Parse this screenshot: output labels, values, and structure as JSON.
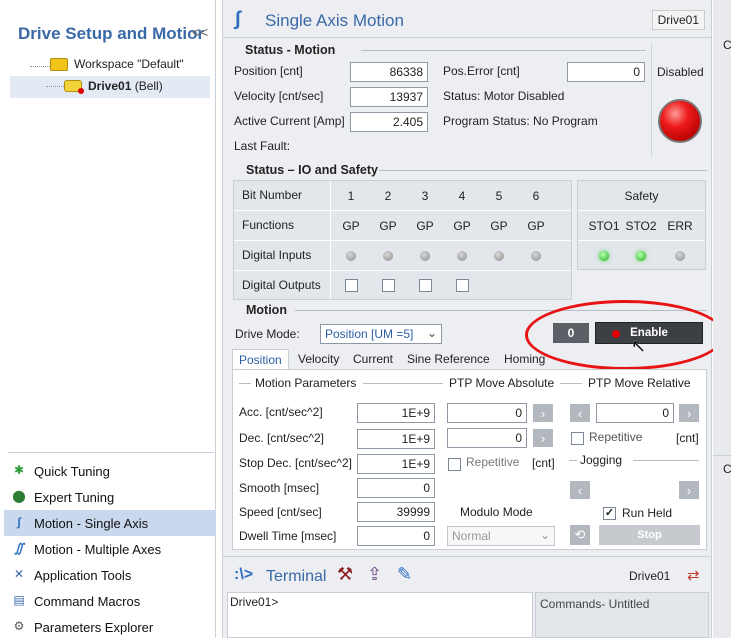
{
  "left": {
    "title": "Drive Setup and Motior",
    "collapse": "<<",
    "tree": {
      "workspace": "Workspace \"Default\"",
      "drive": "Drive01",
      "drive_suffix": "(Bell)"
    },
    "nav": [
      {
        "label": "Quick Tuning",
        "icon": "quick-tuning-icon"
      },
      {
        "label": "Expert Tuning",
        "icon": "expert-tuning-icon"
      },
      {
        "label": "Motion - Single Axis",
        "icon": "motion-single-icon"
      },
      {
        "label": "Motion - Multiple Axes",
        "icon": "motion-multi-icon"
      },
      {
        "label": "Application Tools",
        "icon": "tools-icon"
      },
      {
        "label": "Command Macros",
        "icon": "macros-icon"
      },
      {
        "label": "Parameters Explorer",
        "icon": "params-icon"
      }
    ]
  },
  "header": {
    "title": "Single Axis Motion",
    "drive": "Drive01"
  },
  "status_motion": {
    "title": "Status - Motion",
    "position_label": "Position [cnt]",
    "position": "86338",
    "velocity_label": "Velocity [cnt/sec]",
    "velocity": "13937",
    "current_label": "Active Current [Amp]",
    "current": "2.405",
    "last_fault_label": "Last Fault:",
    "pos_error_label": "Pos.Error [cnt]",
    "pos_error": "0",
    "status_text": "Status: Motor Disabled",
    "program_status": "Program Status: No Program",
    "disabled": "Disabled"
  },
  "io": {
    "title": "Status – IO and Safety",
    "bit_number": "Bit Number",
    "functions": "Functions",
    "digital_inputs": "Digital Inputs",
    "digital_outputs": "Digital Outputs",
    "bits": [
      "1",
      "2",
      "3",
      "4",
      "5",
      "6"
    ],
    "funcs": [
      "GP",
      "GP",
      "GP",
      "GP",
      "GP",
      "GP"
    ],
    "safety": "Safety",
    "safety_cols": [
      "STO1",
      "STO2",
      "ERR"
    ]
  },
  "motion": {
    "title": "Motion",
    "drive_mode_label": "Drive Mode:",
    "drive_mode": "Position [UM =5]",
    "zero_btn": "0",
    "enable_btn": "Enable",
    "tabs": [
      "Position",
      "Velocity",
      "Current",
      "Sine Reference",
      "Homing"
    ],
    "params_title": "Motion Parameters",
    "ptp_abs": "PTP Move Absolute",
    "ptp_rel": "PTP Move Relative",
    "acc_label": "Acc. [cnt/sec^2]",
    "acc": "1E+9",
    "dec_label": "Dec. [cnt/sec^2]",
    "dec": "1E+9",
    "stopdec_label": "Stop Dec. [cnt/sec^2]",
    "stopdec": "1E+9",
    "smooth_label": "Smooth [msec]",
    "smooth": "0",
    "speed_label": "Speed [cnt/sec]",
    "speed": "39999",
    "dwell_label": "Dwell Time [msec]",
    "dwell": "0",
    "abs_val1": "0",
    "abs_val2": "0",
    "rel_val": "0",
    "repetitive": "Repetitive",
    "cnt": "[cnt]",
    "jogging": "Jogging",
    "run_held": "Run Held",
    "modulo_label": "Modulo Mode",
    "modulo_value": "Normal",
    "stop": "Stop"
  },
  "terminal": {
    "title": "Terminal",
    "drive": "Drive01",
    "prompt": "Drive01>",
    "commands": "Commands- Untitled"
  },
  "right": {
    "c1": "C",
    "c2": "C"
  }
}
